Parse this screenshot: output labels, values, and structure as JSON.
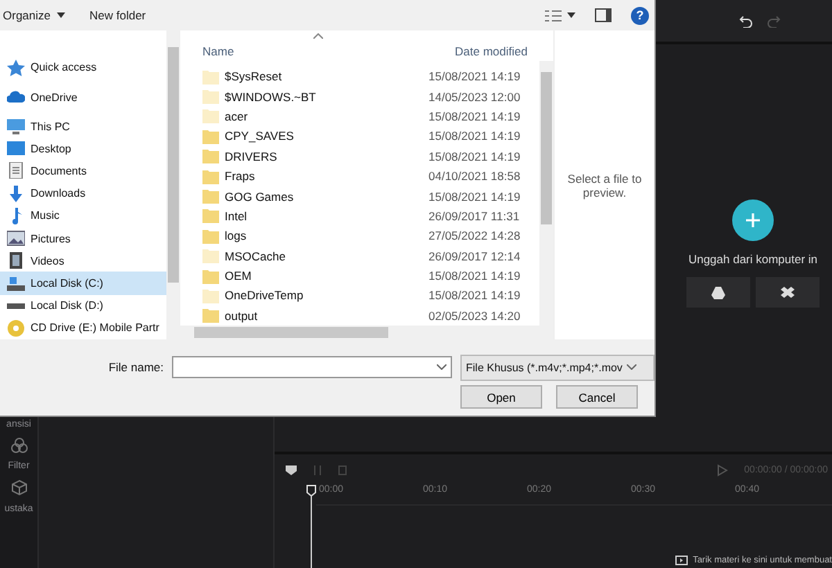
{
  "dialog": {
    "toolbar": {
      "organize": "Organize",
      "new_folder": "New folder",
      "help": "?"
    },
    "nav": [
      {
        "label": "Quick access",
        "kind": "star",
        "selected": false
      },
      {
        "label": "OneDrive",
        "kind": "cloud",
        "selected": false
      },
      {
        "label": "This PC",
        "kind": "pc",
        "selected": false,
        "children": [
          {
            "label": "Desktop",
            "kind": "desktop",
            "selected": false
          },
          {
            "label": "Documents",
            "kind": "doc",
            "selected": false
          },
          {
            "label": "Downloads",
            "kind": "download",
            "selected": false
          },
          {
            "label": "Music",
            "kind": "music",
            "selected": false
          },
          {
            "label": "Pictures",
            "kind": "pictures",
            "selected": false
          },
          {
            "label": "Videos",
            "kind": "videos",
            "selected": false
          },
          {
            "label": "Local Disk (C:)",
            "kind": "disk",
            "selected": true
          },
          {
            "label": "Local Disk (D:)",
            "kind": "drive",
            "selected": false
          },
          {
            "label": "CD Drive (E:) Mobile Partr",
            "kind": "cd",
            "selected": false
          }
        ]
      }
    ],
    "columns": [
      "Name",
      "Date modified"
    ],
    "files": [
      {
        "name": "$SysReset",
        "date": "15/08/2021 14:19",
        "hidden": true
      },
      {
        "name": "$WINDOWS.~BT",
        "date": "14/05/2023 12:00",
        "hidden": true
      },
      {
        "name": "acer",
        "date": "15/08/2021 14:19",
        "hidden": true
      },
      {
        "name": "CPY_SAVES",
        "date": "15/08/2021 14:19",
        "hidden": false
      },
      {
        "name": "DRIVERS",
        "date": "15/08/2021 14:19",
        "hidden": false
      },
      {
        "name": "Fraps",
        "date": "04/10/2021 18:58",
        "hidden": false
      },
      {
        "name": "GOG Games",
        "date": "15/08/2021 14:19",
        "hidden": false
      },
      {
        "name": "Intel",
        "date": "26/09/2017 11:31",
        "hidden": false
      },
      {
        "name": "logs",
        "date": "27/05/2022 14:28",
        "hidden": false
      },
      {
        "name": "MSOCache",
        "date": "26/09/2017 12:14",
        "hidden": true
      },
      {
        "name": "OEM",
        "date": "15/08/2021 14:19",
        "hidden": false
      },
      {
        "name": "OneDriveTemp",
        "date": "15/08/2021 14:19",
        "hidden": true
      },
      {
        "name": "output",
        "date": "02/05/2023 14:20",
        "hidden": false
      }
    ],
    "preview_hint": "Select a file to preview.",
    "file_name_label": "File name:",
    "file_type": "File Khusus (*.m4v;*.mp4;*.mov",
    "buttons": [
      "Open",
      "Cancel"
    ]
  },
  "editor": {
    "sidebar": [
      "ansisi",
      "Filter",
      "ustaka"
    ],
    "upload_label": "Unggah dari komputer in",
    "timecode": "00:00:00 / 00:00:00",
    "ruler": [
      "00:00",
      "00:10",
      "00:20",
      "00:30",
      "00:40"
    ],
    "hint": "Tarik materi ke sini untuk membuat"
  }
}
